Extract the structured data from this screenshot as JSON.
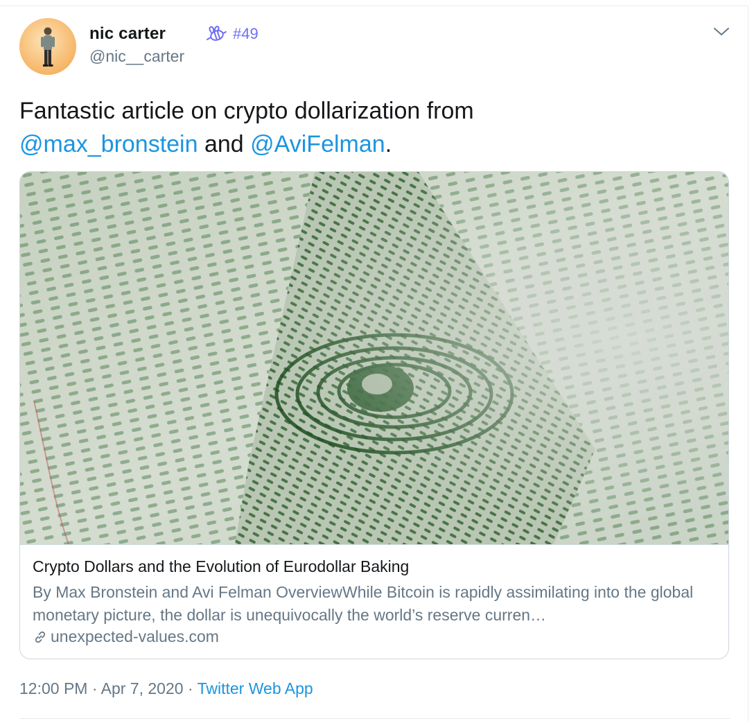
{
  "author": {
    "name": "nic carter",
    "handle": "@nic__carter",
    "badge_icon": "bee-icon",
    "badge_text": "#49"
  },
  "tweet": {
    "text_before": "Fantastic article on crypto dollarization from",
    "mention_1": "@max_bronstein",
    "text_and": "and",
    "mention_2": "@AviFelman",
    "text_end": "."
  },
  "card": {
    "image_icon": "dollar-bill-eye-image",
    "title": "Crypto Dollars and the Evolution of Eurodollar Baking",
    "description": "By Max Bronstein and Avi Felman OverviewWhile Bitcoin is rapidly assimilating into the global monetary picture, the dollar is unequivocally the world’s reserve curren…",
    "domain_icon": "link-icon",
    "domain": "unexpected-values.com"
  },
  "meta": {
    "time": "12:00 PM",
    "separator": "·",
    "date": "Apr 7, 2020",
    "source": "Twitter Web App"
  },
  "colors": {
    "link": "#1b95e0",
    "muted": "#657786",
    "text": "#14171a",
    "badge": "#6e6ef5",
    "border": "#ccd6dd"
  }
}
